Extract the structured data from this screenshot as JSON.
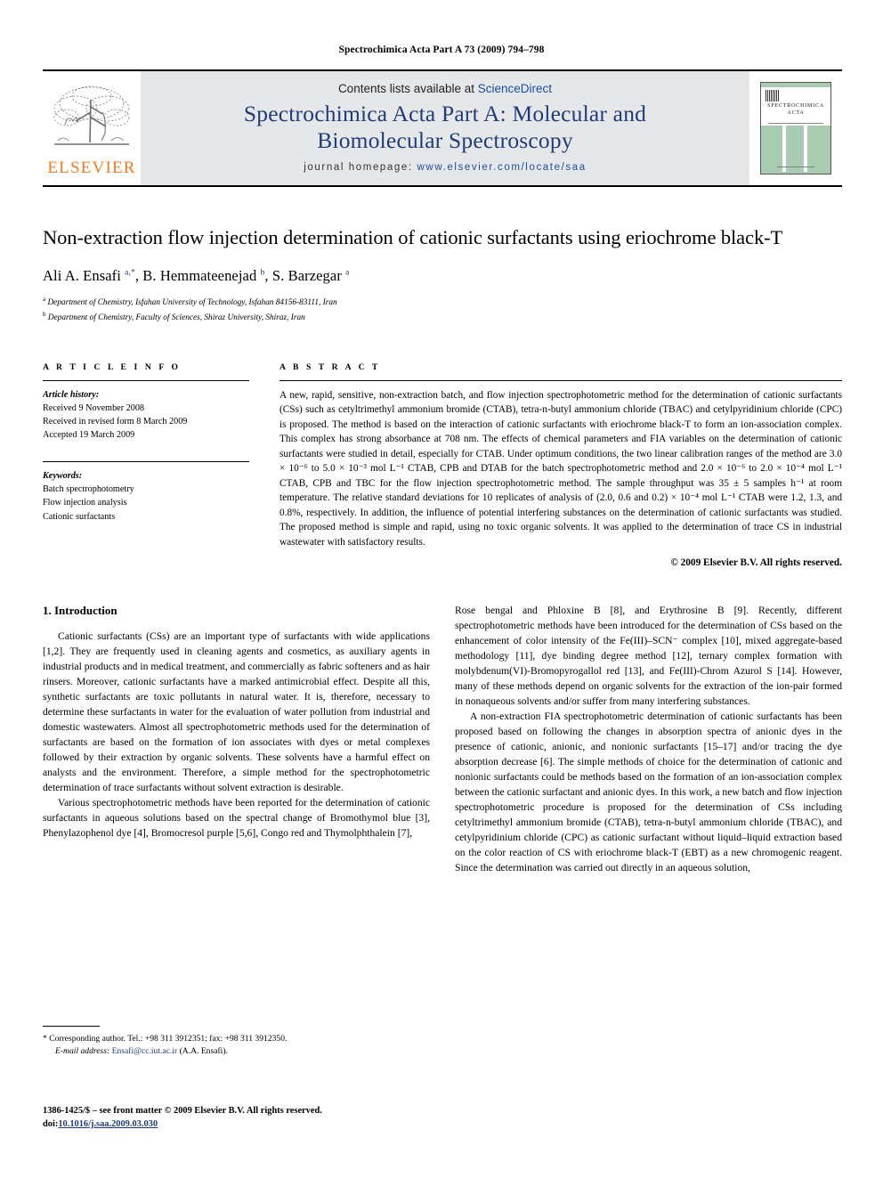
{
  "running_head": "Spectrochimica Acta Part A 73 (2009) 794–798",
  "masthead": {
    "publisher_name": "ELSEVIER",
    "contents_prefix": "Contents lists available at ",
    "contents_link": "ScienceDirect",
    "journal_title_line1": "Spectrochimica Acta Part A: Molecular and",
    "journal_title_line2": "Biomolecular Spectroscopy",
    "homepage_label": "journal homepage:",
    "homepage_url": "www.elsevier.com/locate/saa",
    "cover_title_line1": "SPECTROCHIMICA",
    "cover_title_line2": "ACTA",
    "accent_color": "#F47B20",
    "journal_title_color": "#1f3c7a",
    "link_color": "#1a4fa0",
    "masthead_bg": "#E6E7E9",
    "cover_green": "#a9cbb2"
  },
  "article": {
    "title": "Non-extraction flow injection determination of cationic surfactants using eriochrome black-T",
    "authors_html": "Ali A. Ensafi <sup>a,*</sup>, B. Hemmateenejad <sup>b</sup>, S. Barzegar <sup>a</sup>",
    "affiliation_a": "Department of Chemistry, Isfahan University of Technology, Isfahan 84156-83111, Iran",
    "affiliation_b": "Department of Chemistry, Faculty of Sciences, Shiraz University, Shiraz, Iran"
  },
  "article_info": {
    "heading": "A R T I C L E   I N F O",
    "history_label": "Article history:",
    "history": [
      "Received 9 November 2008",
      "Received in revised form 8 March 2009",
      "Accepted 19 March 2009"
    ],
    "keywords_label": "Keywords:",
    "keywords": [
      "Batch spectrophotometry",
      "Flow injection analysis",
      "Cationic surfactants"
    ]
  },
  "abstract": {
    "heading": "A B S T R A C T",
    "text": "A new, rapid, sensitive, non-extraction batch, and flow injection spectrophotometric method for the determination of cationic surfactants (CSs) such as cetyltrimethyl ammonium bromide (CTAB), tetra-n-butyl ammonium chloride (TBAC) and cetylpyridinium chloride (CPC) is proposed. The method is based on the interaction of cationic surfactants with eriochrome black-T to form an ion-association complex. This complex has strong absorbance at 708 nm. The effects of chemical parameters and FIA variables on the determination of cationic surfactants were studied in detail, especially for CTAB. Under optimum conditions, the two linear calibration ranges of the method are 3.0 × 10⁻⁶ to 5.0 × 10⁻³ mol L⁻¹ CTAB, CPB and DTAB for the batch spectrophotometric method and 2.0 × 10⁻⁶ to 2.0 × 10⁻⁴ mol L⁻¹ CTAB, CPB and TBC for the flow injection spectrophotometric method. The sample throughput was 35 ± 5 samples h⁻¹ at room temperature. The relative standard deviations for 10 replicates of analysis of (2.0, 0.6 and 0.2) × 10⁻⁴ mol L⁻¹ CTAB were 1.2, 1.3, and 0.8%, respectively. In addition, the influence of potential interfering substances on the determination of cationic surfactants was studied. The proposed method is simple and rapid, using no toxic organic solvents. It was applied to the determination of trace CS in industrial wastewater with satisfactory results.",
    "copyright": "© 2009 Elsevier B.V. All rights reserved."
  },
  "introduction": {
    "heading": "1.  Introduction",
    "left_p1": "Cationic surfactants (CSs) are an important type of surfactants with wide applications [1,2]. They are frequently used in cleaning agents and cosmetics, as auxiliary agents in industrial products and in medical treatment, and commercially as fabric softeners and as hair rinsers. Moreover, cationic surfactants have a marked antimicrobial effect. Despite all this, synthetic surfactants are toxic pollutants in natural water. It is, therefore, necessary to determine these surfactants in water for the evaluation of water pollution from industrial and domestic wastewaters. Almost all spectrophotometric methods used for the determination of surfactants are based on the formation of ion associates with dyes or metal complexes followed by their extraction by organic solvents. These solvents have a harmful effect on analysts and the environment. Therefore, a simple method for the spectrophotometric determination of trace surfactants without solvent extraction is desirable.",
    "left_p2": "Various spectrophotometric methods have been reported for the determination of cationic surfactants in aqueous solutions based on the spectral change of Bromothymol blue [3], Phenylazophenol dye [4], Bromocresol purple [5,6], Congo red and Thymolphthalein [7],",
    "right_p1": "Rose bengal and Phloxine B [8], and Erythrosine B [9]. Recently, different spectrophotometric methods have been introduced for the determination of CSs based on the enhancement of color intensity of the Fe(III)–SCN⁻ complex [10], mixed aggregate-based methodology [11], dye binding degree method [12], ternary complex formation with molybdenum(VI)-Bromopyrogallol red [13], and Fe(III)-Chrom Azurol S [14]. However, many of these methods depend on organic solvents for the extraction of the ion-pair formed in nonaqueous solvents and/or suffer from many interfering substances.",
    "right_p2": "A non-extraction FIA spectrophotometric determination of cationic surfactants has been proposed based on following the changes in absorption spectra of anionic dyes in the presence of cationic, anionic, and nonionic surfactants [15–17] and/or tracing the dye absorption decrease [6]. The simple methods of choice for the determination of cationic and nonionic surfactants could be methods based on the formation of an ion-association complex between the cationic surfactant and anionic dyes. In this work, a new batch and flow injection spectrophotometric procedure is proposed for the determination of CSs including cetyltrimethyl ammonium bromide (CTAB), tetra-n-butyl ammonium chloride (TBAC), and cetylpyridinium chloride (CPC) as cationic surfactant without liquid–liquid extraction based on the color reaction of CS with eriochrome black-T (EBT) as a new chromogenic reagent. Since the determination was carried out directly in an aqueous solution,"
  },
  "footnote": {
    "marker": "*",
    "corresponding": "Corresponding author. Tel.: +98 311 3912351; fax: +98 311 3912350.",
    "email_label": "E-mail address:",
    "email": "Ensafi@cc.iut.ac.ir",
    "email_suffix": "(A.A. Ensafi)."
  },
  "imprint": {
    "line1": "1386-1425/$ – see front matter © 2009 Elsevier B.V. All rights reserved.",
    "doi_label": "doi:",
    "doi_value": "10.1016/j.saa.2009.03.030"
  }
}
